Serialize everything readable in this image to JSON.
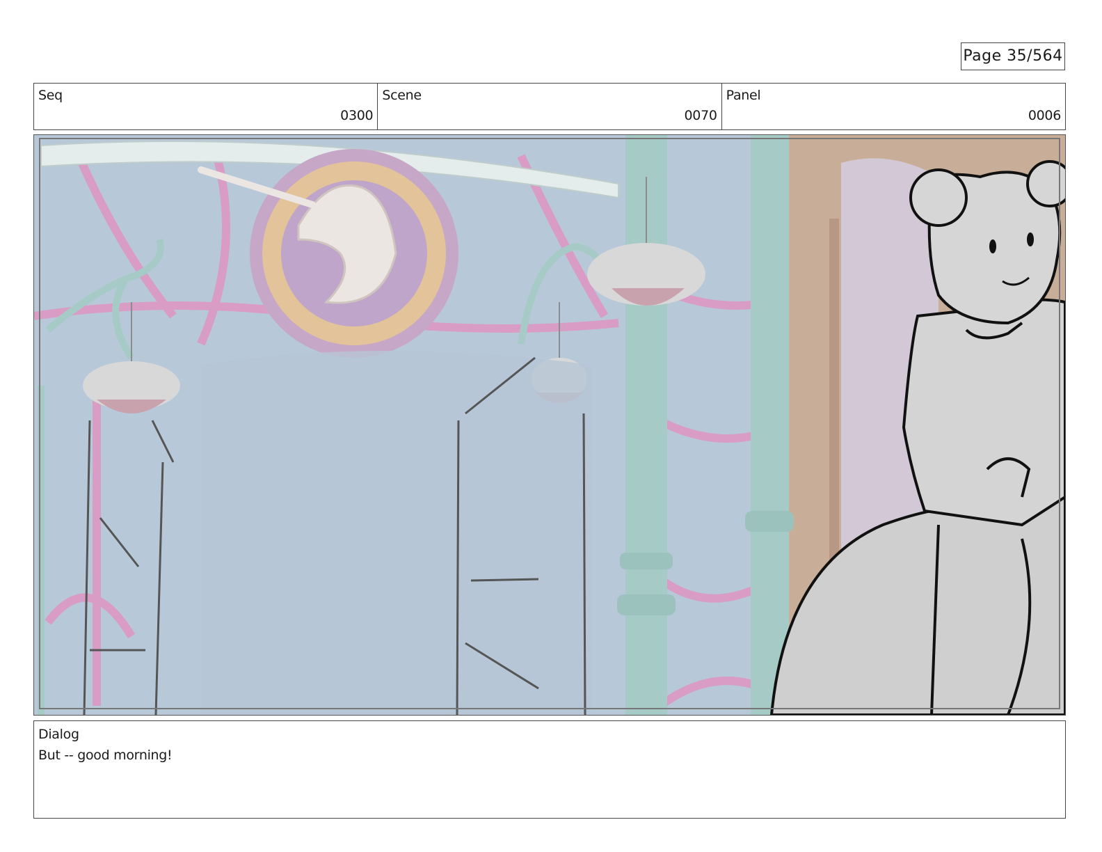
{
  "page": {
    "label": "Page",
    "number": "35/564"
  },
  "header": {
    "seq": {
      "label": "Seq",
      "value": "0300"
    },
    "scene": {
      "label": "Scene",
      "value": "0070"
    },
    "panel": {
      "label": "Panel",
      "value": "0006"
    }
  },
  "dialog": {
    "label": "Dialog",
    "text": "But -- good morning!"
  },
  "colors": {
    "sky": "#b5c8d8",
    "ironwork_pink": "#d99cc4",
    "ironwork_teal": "#a6cbc6",
    "emblem_gold": "#e2c39a",
    "wall_tan": "#c9ad96",
    "sketch_fill": "#cfcfcf"
  }
}
